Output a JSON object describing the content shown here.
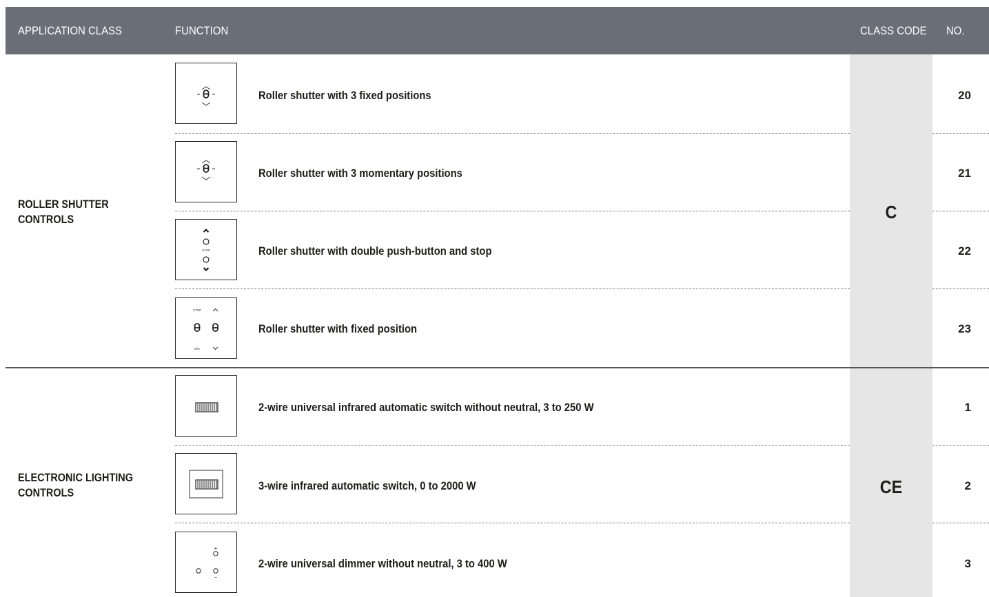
{
  "header": {
    "application_class": "APPLICATION CLASS",
    "function": "FUNCTION",
    "class_code": "CLASS CODE",
    "no": "NO."
  },
  "groups": [
    {
      "class_line1": "ROLLER SHUTTER",
      "class_line2": "CONTROLS",
      "class_code": "C",
      "rows": [
        {
          "icon": "toggle-three-position-icon",
          "function": "Roller shutter with 3 fixed positions",
          "no": "20"
        },
        {
          "icon": "toggle-three-position-icon",
          "function": "Roller shutter with 3 momentary positions",
          "no": "21"
        },
        {
          "icon": "up-stop-down-buttons-icon",
          "function": "Roller shutter with double push-button and stop",
          "no": "22",
          "icon_text": "STOP"
        },
        {
          "icon": "double-toggle-icon",
          "function": "Roller shutter with fixed position",
          "no": "23",
          "icon_text_top": "STOP",
          "icon_text_bottom": "M/A"
        }
      ]
    },
    {
      "class_line1": "ELECTRONIC LIGHTING",
      "class_line2": "CONTROLS",
      "class_code": "CE",
      "rows": [
        {
          "icon": "infrared-sensor-icon",
          "function": "2-wire universal infrared automatic switch without neutral, 3 to 250 W",
          "no": "1"
        },
        {
          "icon": "framed-infrared-sensor-icon",
          "function": "3-wire infrared automatic switch, 0 to 2000 W",
          "no": "2"
        },
        {
          "icon": "dimmer-buttons-icon",
          "function": "2-wire universal dimmer without neutral, 3 to 400 W",
          "no": "3",
          "icon_text_plus": "+",
          "icon_text_minus": "−"
        }
      ]
    }
  ]
}
